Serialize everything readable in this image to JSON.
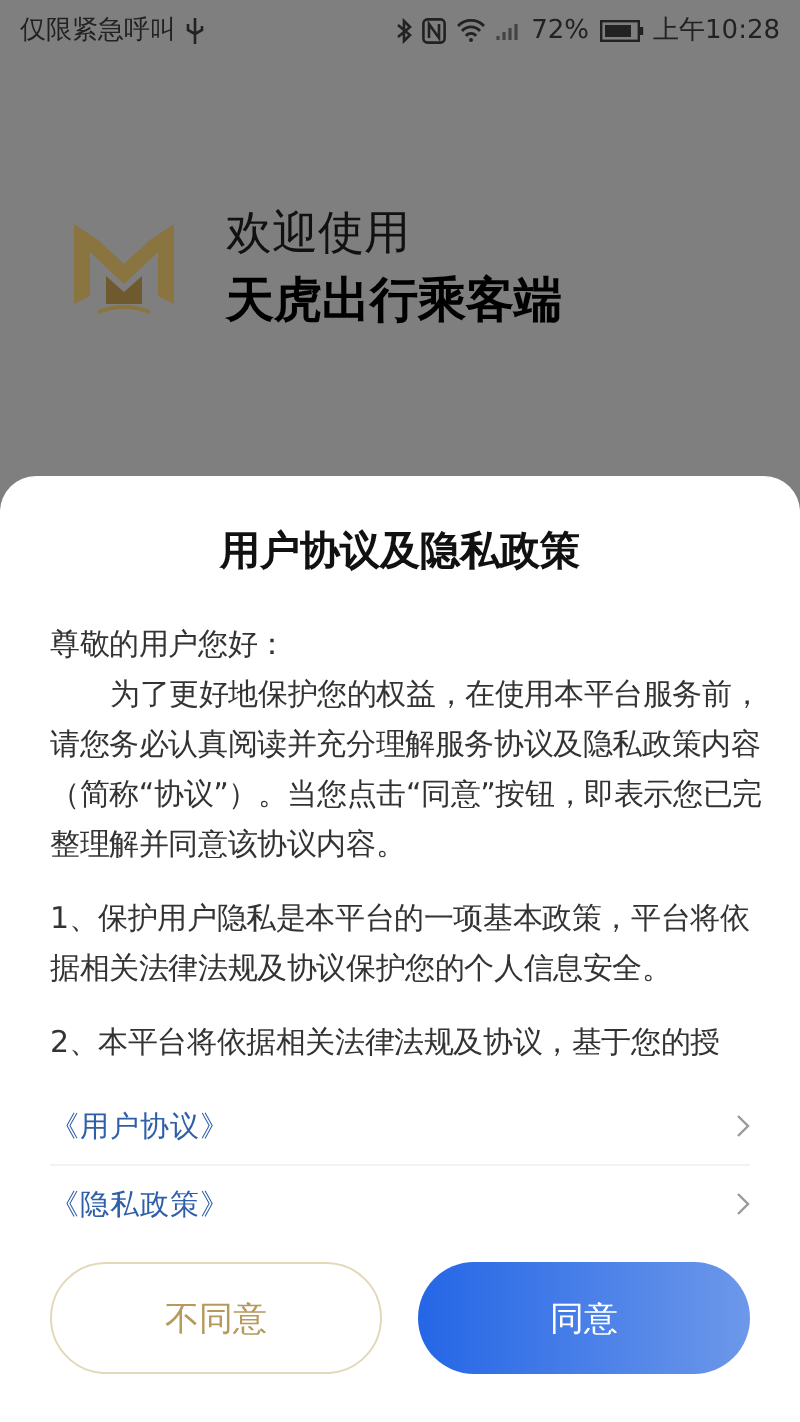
{
  "status_bar": {
    "carrier": "仅限紧急呼叫",
    "battery": "72%",
    "time": "上午10:28"
  },
  "welcome": {
    "line1": "欢迎使用",
    "line2": "天虎出行乘客端"
  },
  "dialog": {
    "title": "用户协议及隐私政策",
    "paragraphs": [
      {
        "kind": "greeting",
        "text": "尊敬的用户您好："
      },
      {
        "kind": "indented",
        "text": "为了更好地保护您的权益，在使用本平台服务前，请您务必认真阅读并充分理解服务协议及隐私政策内容（简称“协议”）。当您点击“同意”按钮，即表示您已完整理解并同意该协议内容。"
      },
      {
        "kind": "item",
        "text": "1、保护用户隐私是本平台的一项基本政策，平台将依据相关法律法规及协议保护您的个人信息安全。"
      },
      {
        "kind": "item",
        "text": "2、本平台将依据相关法律法规及协议，基于您的授"
      }
    ],
    "links": [
      "《用户协议》",
      "《隐私政策》"
    ],
    "buttons": [
      {
        "label": "不同意",
        "kind": "decline"
      },
      {
        "label": "同意",
        "kind": "accept"
      }
    ]
  }
}
